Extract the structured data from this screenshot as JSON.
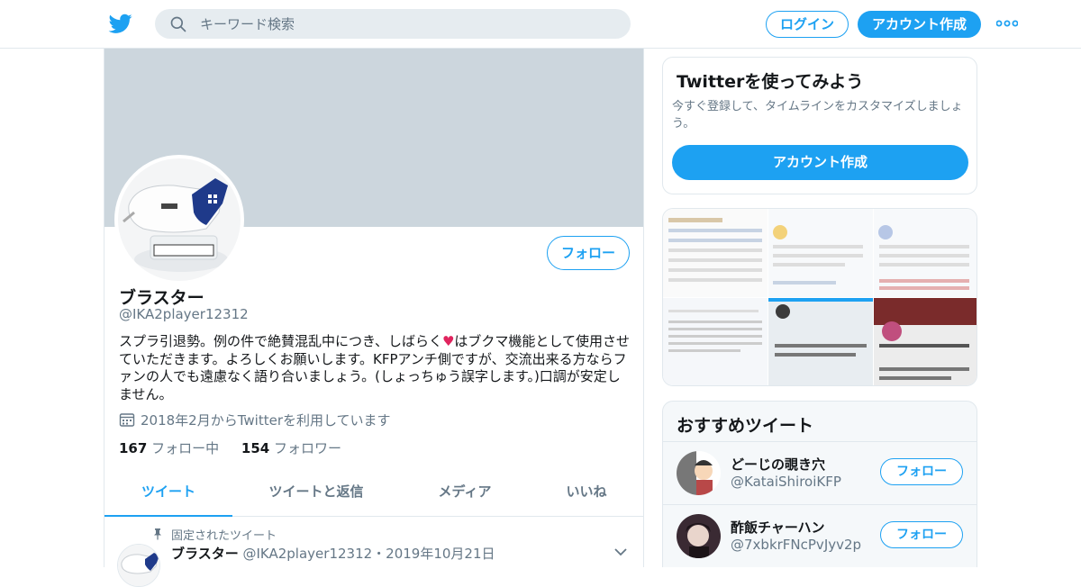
{
  "colors": {
    "accent": "#1da1f2",
    "banner": "#ccd6dd",
    "muted": "#657786",
    "heart": "#e0245e"
  },
  "nav": {
    "search_placeholder": "キーワード検索",
    "login": "ログイン",
    "signup": "アカウント作成"
  },
  "profile": {
    "follow": "フォロー",
    "name": "ブラスター",
    "handle": "@IKA2player12312",
    "bio_before": "スプラ引退勢。例の件で絶賛混乱中につき、しばらく",
    "bio_after": "はブクマ機能として使用させていただきます。よろしくお願いします。KFPアンチ側ですが、交流出来る方ならファンの人でも遠慮なく語り合いましょう。(しょっちゅう誤字します。)口調が安定しません。",
    "joined": "2018年2月からTwitterを利用しています",
    "following_count": "167",
    "following_label": "フォロー中",
    "followers_count": "154",
    "followers_label": "フォロワー"
  },
  "tabs": [
    {
      "label": "ツイート"
    },
    {
      "label": "ツイートと返信"
    },
    {
      "label": "メディア"
    },
    {
      "label": "いいね"
    }
  ],
  "pinned": {
    "label": "固定されたツイート",
    "name": "ブラスター",
    "handle": "@IKA2player12312",
    "date": "・2019年10月21日"
  },
  "signup_card": {
    "title": "Twitterを使ってみよう",
    "desc": "今すぐ登録して、タイムラインをカスタマイズしましょう。",
    "cta": "アカウント作成"
  },
  "recommended": {
    "title": "おすすめツイート",
    "follow": "フォロー",
    "users": [
      {
        "name": "どーじの覗き穴",
        "handle": "@KataiShiroiKFP"
      },
      {
        "name": "酢飯チャーハン",
        "handle": "@7xbkrFNcPvJyv2p"
      }
    ]
  }
}
